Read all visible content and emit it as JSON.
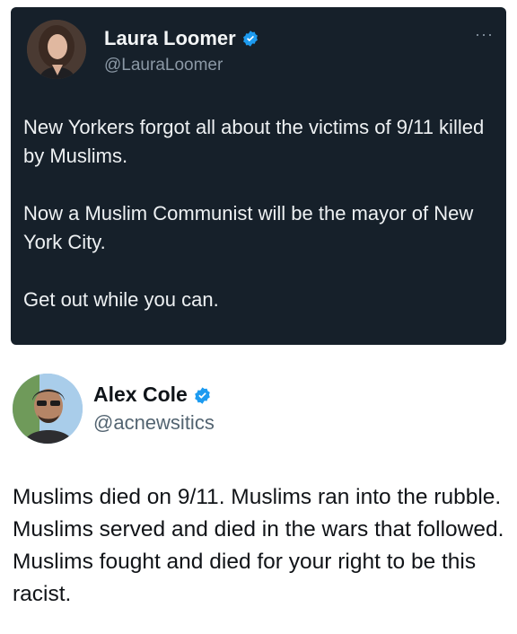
{
  "tweet1": {
    "display_name": "Laura Loomer",
    "handle": "@LauraLoomer",
    "more_label": "···",
    "paragraphs": [
      "New Yorkers forgot all about the victims of 9/11 killed by Muslims.",
      "Now a Muslim Communist will be the mayor of New York City.",
      "Get out while you can."
    ],
    "colors": {
      "background": "#16202a",
      "text": "#eef1f3",
      "muted": "#8b98a5"
    }
  },
  "tweet2": {
    "display_name": "Alex Cole",
    "handle": "@acnewsitics",
    "text": "Muslims died on 9/11. Muslims ran into the rubble. Muslims served and died in the wars that followed. Muslims fought and died for your right to be this racist.",
    "colors": {
      "text": "#111418",
      "muted": "#536471"
    }
  },
  "verified_color": "#1d9bf0",
  "icons": [
    "verified-badge-icon",
    "more-options-icon"
  ]
}
